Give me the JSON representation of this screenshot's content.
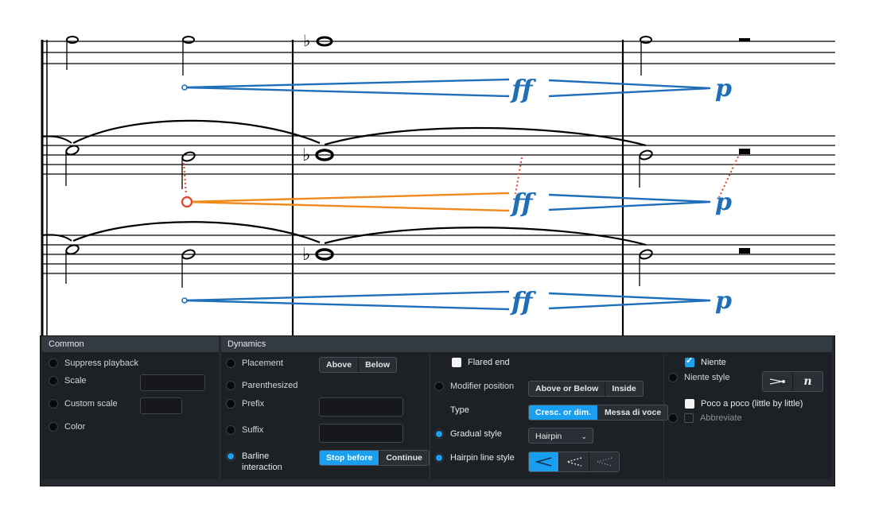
{
  "score": {
    "dynamics": [
      {
        "start": "ff",
        "end": "p"
      },
      {
        "start": "ff",
        "end": "p"
      },
      {
        "start": "ff",
        "end": "p"
      }
    ]
  },
  "colors": {
    "hairpin": "#1f6fb8",
    "selected": "#f08a1c",
    "anchor": "#e8402a",
    "accent": "#1aa0f0",
    "panel_bg": "#1d2025"
  },
  "panel": {
    "common": {
      "title": "Common",
      "suppress_playback": "Suppress playback",
      "scale": "Scale",
      "custom_scale": "Custom scale",
      "color": "Color"
    },
    "dynamics": {
      "title": "Dynamics",
      "placement": "Placement",
      "placement_options": [
        "Above",
        "Below"
      ],
      "parenthesized": "Parenthesized",
      "prefix": "Prefix",
      "suffix": "Suffix",
      "barline_interaction_1": "Barline",
      "barline_interaction_2": "interaction",
      "barline_options": [
        "Stop before",
        "Continue"
      ],
      "flared_end": "Flared end",
      "modifier_position": "Modifier position",
      "modifier_options": [
        "Above or Below",
        "Inside"
      ],
      "type": "Type",
      "type_options": [
        "Cresc. or dim.",
        "Messa di voce"
      ],
      "gradual_style": "Gradual style",
      "gradual_style_value": "Hairpin",
      "hairpin_line_style": "Hairpin line style",
      "niente": "Niente",
      "niente_style": "Niente style",
      "niente_glyph": "n",
      "poco_a_poco": "Poco a poco (little by little)",
      "abbreviate": "Abbreviate"
    },
    "icons": {
      "hairpin_solid": "hairpin-solid-icon",
      "hairpin_dashed": "hairpin-dashed-icon",
      "hairpin_dotted": "hairpin-dotted-icon",
      "niente_circle": "niente-circle-icon",
      "niente_letter": "niente-letter-icon"
    }
  }
}
